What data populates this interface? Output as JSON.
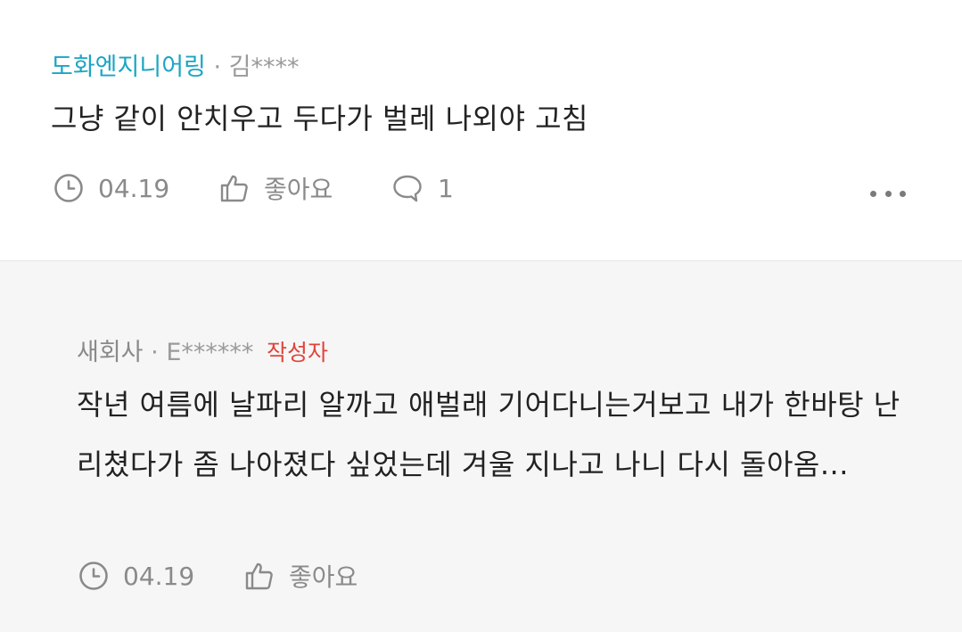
{
  "comment": {
    "company": "도화엔지니어링",
    "separator": "·",
    "author": "김****",
    "text": "그냥 같이 안치우고 두다가 벌레 나외야 고침",
    "date": "04.19",
    "like_label": "좋아요",
    "reply_count": "1",
    "more_icon": "more-icon",
    "colors": {
      "company": "#1aa6c4"
    }
  },
  "reply": {
    "company": "새회사",
    "separator": "·",
    "author": "E******",
    "writer_badge": "작성자",
    "text": "작년 여름에 날파리 알까고 애벌래 기어다니는거보고 내가 한바탕 난리쳤다가 좀 나아졌다 싶었는데 겨울 지나고 나니 다시 돌아옴...",
    "date": "04.19",
    "like_label": "좋아요",
    "colors": {
      "badge": "#e0443b",
      "background": "#f6f6f6"
    }
  }
}
